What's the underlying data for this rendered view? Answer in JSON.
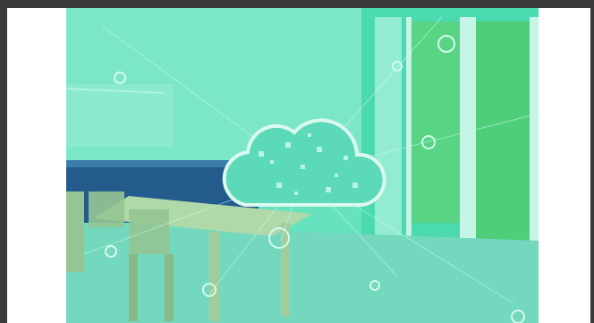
{
  "image": {
    "subject": "smart-home-cloud-overlay",
    "colors": {
      "frame": "#3a3a3a",
      "page": "#ffffff",
      "tint": "#3ee0b0",
      "wall": "#7fe6c8",
      "cabinet": "#1f3f86",
      "table": "#c9d8a8"
    }
  }
}
